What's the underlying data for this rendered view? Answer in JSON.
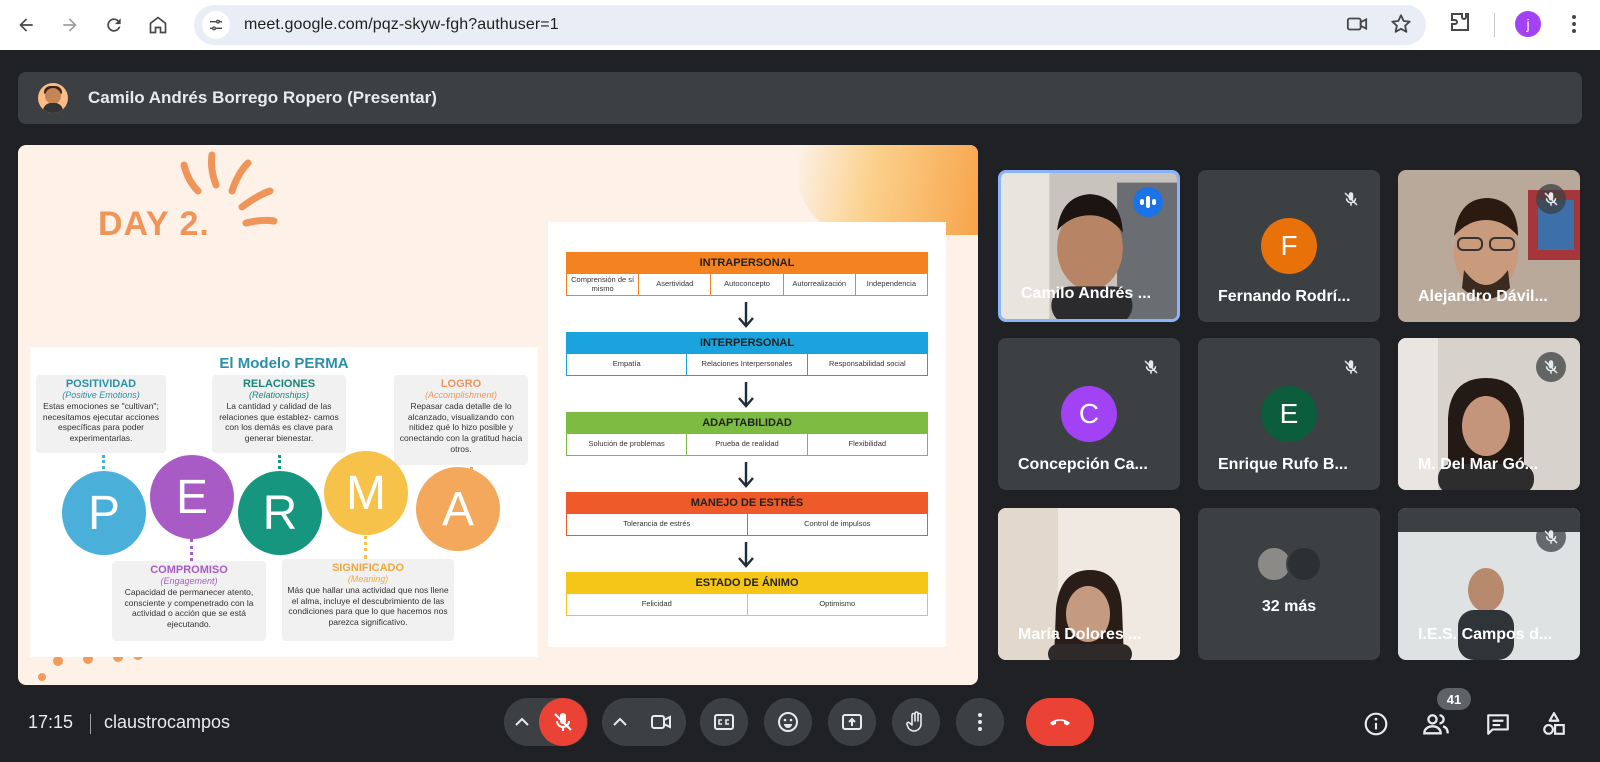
{
  "browser": {
    "url": "meet.google.com/pqz-skyw-fgh?authuser=1",
    "profile_initial": "j",
    "icons": [
      "back-icon",
      "forward-icon",
      "reload-icon",
      "home-icon",
      "tune-icon",
      "camera-icon",
      "star-icon",
      "extensions-icon",
      "menu-icon"
    ]
  },
  "presenter": {
    "label": "Camilo Andrés Borrego Ropero (Presentar)"
  },
  "slide": {
    "day_title": "DAY 2.",
    "perma": {
      "title": "El Modelo PERMA",
      "letters": [
        "P",
        "E",
        "R",
        "M",
        "A"
      ],
      "boxes": {
        "positividad": {
          "heading": "POSITIVIDAD",
          "sub": "(Positive Emotions)",
          "text": "Estas emociones se \"cultivan\"; necesitamos ejecutar acciones específicas para poder experimentarlas."
        },
        "relaciones": {
          "heading": "RELACIONES",
          "sub": "(Relationships)",
          "text": "La cantidad y calidad de las relaciones que establez- camos con los demás es clave para generar bienestar."
        },
        "logro": {
          "heading": "LOGRO",
          "sub": "(Accomplishment)",
          "text": "Repasar cada detalle de lo alcanzado, visualizando con nitidez qué lo hizo posible y conectando con la gratitud hacia otros."
        },
        "compromiso": {
          "heading": "COMPROMISO",
          "sub": "(Engagement)",
          "text": "Capacidad de permanecer atento, consciente y compenetrado con la actividad o acción que se está ejecutando."
        },
        "significado": {
          "heading": "SIGNIFICADO",
          "sub": "(Meaning)",
          "text": "Más que hallar una actividad que nos llene el alma, incluye el descubrimiento de las condiciones para que lo que hacemos nos parezca significativo."
        }
      }
    },
    "eq": [
      {
        "title": "INTRAPERSONAL",
        "color": "#f58220",
        "cells": [
          "Comprensión de sí mismo",
          "Asertividad",
          "Autoconcepto",
          "Autorrealización",
          "Independencia"
        ]
      },
      {
        "title": "INTERPERSONAL",
        "color": "#1aa3dc",
        "cells": [
          "Empatía",
          "Relaciones Interpersonales",
          "Responsabilidad social"
        ]
      },
      {
        "title": "ADAPTABILIDAD",
        "color": "#7dbb42",
        "cells": [
          "Solución de problemas",
          "Prueba de realidad",
          "Flexibilidad"
        ]
      },
      {
        "title": "MANEJO DE ESTRÉS",
        "color": "#ee5a2a",
        "cells": [
          "Tolerancia de estrés",
          "Control de impulsos"
        ]
      },
      {
        "title": "ESTADO DE ÁNIMO",
        "color": "#f5c518",
        "cells": [
          "Felicidad",
          "Optimismo"
        ]
      }
    ]
  },
  "participants": [
    {
      "name": "Camilo Andrés ...",
      "type": "video",
      "speaking": true
    },
    {
      "name": "Fernando Rodrí...",
      "type": "avatar",
      "initial": "F",
      "color": "#e8710a",
      "muted": true
    },
    {
      "name": "Alejandro Dávil...",
      "type": "video",
      "muted": true
    },
    {
      "name": "Concepción Ca...",
      "type": "avatar",
      "initial": "C",
      "color": "#a142f4",
      "muted": true
    },
    {
      "name": "Enrique Rufo B...",
      "type": "avatar",
      "initial": "E",
      "color": "#0b5d3b",
      "muted": true
    },
    {
      "name": "M. Del Mar Gó...",
      "type": "video",
      "muted": true
    },
    {
      "name": "María Dolores ...",
      "type": "video",
      "muted": false
    },
    {
      "name": "32 más",
      "type": "more"
    },
    {
      "name": "I.E.S. Campos d...",
      "type": "video",
      "muted": true
    }
  ],
  "bottom": {
    "time": "17:15",
    "meeting_code": "claustrocampos",
    "participant_count": "41",
    "controls": [
      "mic-off-icon",
      "camera-icon",
      "captions-icon",
      "emoji-icon",
      "present-icon",
      "raise-hand-icon",
      "more-options-icon",
      "end-call-icon"
    ],
    "right_icons": [
      "info-icon",
      "people-icon",
      "chat-icon",
      "activities-icon"
    ]
  },
  "colors": {
    "accent": "#8ab4f8",
    "end_call": "#ea4335",
    "background": "#202124"
  }
}
